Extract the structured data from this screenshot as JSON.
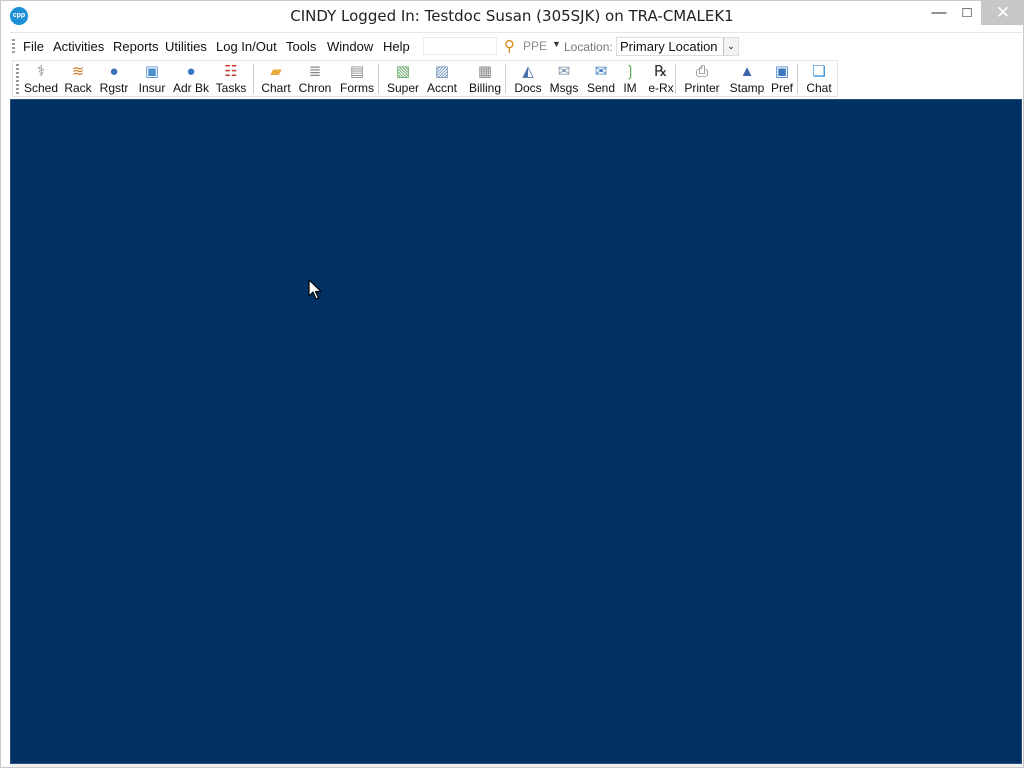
{
  "window": {
    "title": "CINDY Logged In: Testdoc Susan (305SJK) on TRA-CMALEK1",
    "logo_text": "cpp",
    "controls": {
      "minimize": "—",
      "maximize": "□",
      "close": "✕"
    }
  },
  "menu": {
    "items": [
      "File",
      "Activities",
      "Reports",
      "Utilities",
      "Log In/Out",
      "Tools",
      "Window",
      "Help"
    ],
    "quick_search_value": "",
    "ppe_label": "PPE",
    "location_label": "Location:",
    "location_value": "Primary Location"
  },
  "toolbar": {
    "buttons": [
      {
        "label": "Sched",
        "icon": "schedule-icon",
        "glyph": "⚕",
        "color": "#7f7f7f"
      },
      {
        "label": "Rack",
        "icon": "rack-icon",
        "glyph": "≋",
        "color": "#cf7a2a"
      },
      {
        "label": "Rgstr",
        "icon": "register-icon",
        "glyph": "●",
        "color": "#3b6fb6"
      },
      {
        "label": "Insur",
        "icon": "insurance-icon",
        "glyph": "▣",
        "color": "#4c8fcf"
      },
      {
        "label": "Adr Bk",
        "icon": "address-book-icon",
        "glyph": "●",
        "color": "#3a78c2"
      },
      {
        "label": "Tasks",
        "icon": "tasks-icon",
        "glyph": "☷",
        "color": "#c0392b"
      },
      {
        "label": "Chart",
        "icon": "chart-folder-icon",
        "glyph": "▰",
        "color": "#e8a93a"
      },
      {
        "label": "Chron",
        "icon": "chronology-icon",
        "glyph": "≣",
        "color": "#8a8a8a"
      },
      {
        "label": "Forms",
        "icon": "forms-icon",
        "glyph": "▤",
        "color": "#8a8a8a"
      },
      {
        "label": "Super",
        "icon": "superbill-icon",
        "glyph": "▧",
        "color": "#5aa05a"
      },
      {
        "label": "Accnt",
        "icon": "account-icon",
        "glyph": "▨",
        "color": "#6b8fb8"
      },
      {
        "label": "Billing",
        "icon": "billing-icon",
        "glyph": "▦",
        "color": "#8a8a8a"
      },
      {
        "label": "Docs",
        "icon": "documents-icon",
        "glyph": "◭",
        "color": "#4a74a8"
      },
      {
        "label": "Msgs",
        "icon": "messages-icon",
        "glyph": "✉",
        "color": "#7a8fa8"
      },
      {
        "label": "Send",
        "icon": "send-icon",
        "glyph": "✉",
        "color": "#3a78c2"
      },
      {
        "label": "IM",
        "icon": "instant-message-icon",
        "glyph": "❳",
        "color": "#4ba04b"
      },
      {
        "label": "e-Rx",
        "icon": "erx-icon",
        "glyph": "℞",
        "color": "#2d2d2d"
      },
      {
        "label": "Printer",
        "icon": "printer-icon",
        "glyph": "⎙",
        "color": "#6a6a6a"
      },
      {
        "label": "Stamp",
        "icon": "stamp-icon",
        "glyph": "▲",
        "color": "#3a62a8"
      },
      {
        "label": "Pref",
        "icon": "preferences-icon",
        "glyph": "▣",
        "color": "#3a78c2"
      },
      {
        "label": "Chat",
        "icon": "chat-icon",
        "glyph": "❏",
        "color": "#3a8fd6"
      }
    ]
  },
  "colors": {
    "workspace_bg": "#003162",
    "close_button_bg": "#c7c7c7"
  }
}
